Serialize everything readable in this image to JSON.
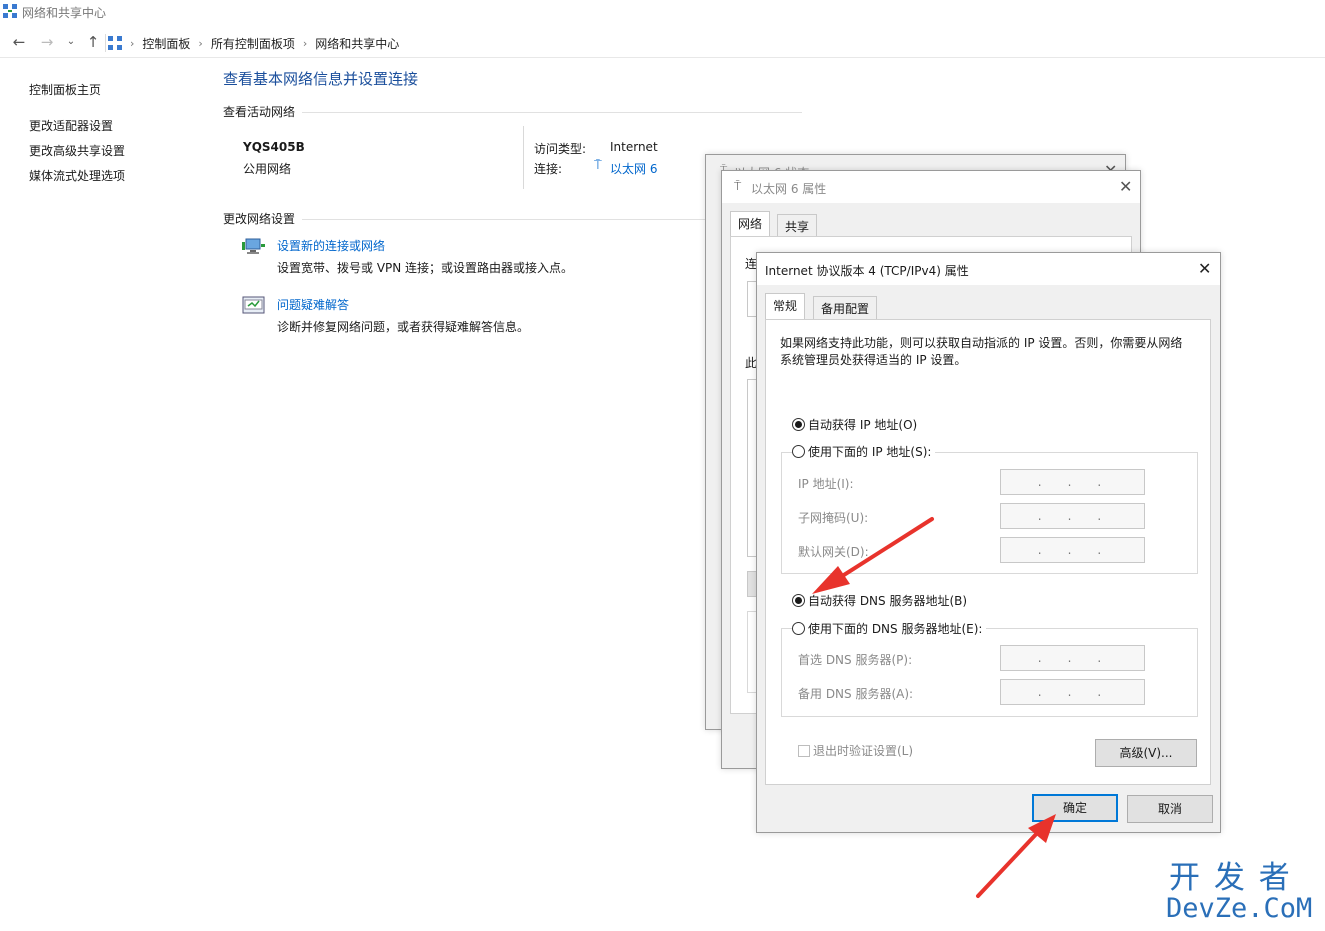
{
  "window": {
    "title": "网络和共享中心"
  },
  "address": {
    "crumbs": [
      "控制面板",
      "所有控制面板项",
      "网络和共享中心"
    ]
  },
  "left_pane": {
    "items": [
      "控制面板主页",
      "更改适配器设置",
      "更改高级共享设置",
      "媒体流式处理选项"
    ]
  },
  "main": {
    "title": "查看基本网络信息并设置连接",
    "active_networks_header": "查看活动网络",
    "network": {
      "name": "YQS405B",
      "type": "公用网络",
      "access_label": "访问类型:",
      "access_value": "Internet",
      "conn_label": "连接:",
      "conn_value": "以太网 6"
    },
    "change_header": "更改网络设置",
    "tasks": [
      {
        "title": "设置新的连接或网络",
        "desc": "设置宽带、拨号或 VPN 连接；或设置路由器或接入点。"
      },
      {
        "title": "问题疑难解答",
        "desc": "诊断并修复网络问题，或者获得疑难解答信息。"
      }
    ]
  },
  "status_dialog": {
    "title": "以太网 6 状态"
  },
  "props_dialog": {
    "title": "以太网 6 属性",
    "tabs": [
      "网络",
      "共享"
    ],
    "fragment_conn": "连",
    "fragment_this": "此"
  },
  "ipv4_dialog": {
    "title": "Internet 协议版本 4 (TCP/IPv4) 属性",
    "tabs": [
      "常规",
      "备用配置"
    ],
    "desc": "如果网络支持此功能，则可以获取自动指派的 IP 设置。否则，你需要从网络系统管理员处获得适当的 IP 设置。",
    "auto_ip": "自动获得 IP 地址(O)",
    "manual_ip": "使用下面的 IP 地址(S):",
    "ip_label": "IP 地址(I):",
    "mask_label": "子网掩码(U):",
    "gateway_label": "默认网关(D):",
    "auto_dns": "自动获得 DNS 服务器地址(B)",
    "manual_dns": "使用下面的 DNS 服务器地址(E):",
    "dns1_label": "首选 DNS 服务器(P):",
    "dns2_label": "备用 DNS 服务器(A):",
    "field_dots": "...",
    "validate": "退出时验证设置(L)",
    "advanced": "高级(V)...",
    "ok": "确定",
    "cancel": "取消",
    "ip_mode": "auto",
    "dns_mode": "auto"
  },
  "watermark": {
    "line1": "开 发 者",
    "line2": "DevZe.CoM"
  },
  "colors": {
    "accent": "#0078d7",
    "link": "#0066cc",
    "arrow": "#e8332c",
    "watermark": "#2a6fb8"
  }
}
